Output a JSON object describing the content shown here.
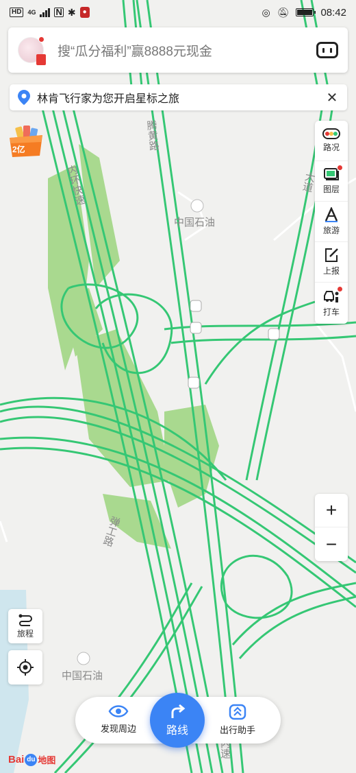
{
  "status_bar": {
    "left_badges": [
      "HD",
      "4G"
    ],
    "time": "08:42"
  },
  "search": {
    "placeholder": "搜“瓜分福利”赢8888元现金"
  },
  "notice": {
    "text": "林肯飞行家为您开启星标之旅"
  },
  "promo": {
    "badge": "2亿"
  },
  "toolbar": {
    "items": [
      {
        "label": "路况",
        "icon": "traffic-light-icon"
      },
      {
        "label": "图层",
        "icon": "layers-icon"
      },
      {
        "label": "旅游",
        "icon": "travel-icon"
      },
      {
        "label": "上报",
        "icon": "report-icon"
      },
      {
        "label": "打车",
        "icon": "taxi-icon"
      }
    ]
  },
  "zoom": {
    "in": "+",
    "out": "−"
  },
  "left_buttons": {
    "itinerary": "旅程"
  },
  "bottom": {
    "discover": "发现周边",
    "route": "路线",
    "assistant": "出行助手"
  },
  "map_labels": {
    "road_tenghuang": "腾黄路",
    "road_inner_ring": "内环快速",
    "road_gong": "弹工路",
    "road_right_top": "大道",
    "road_bottom": "内速",
    "poi_petrochina_1": "中国石油",
    "poi_petrochina_2": "中国石油"
  },
  "logo": {
    "part1": "Bai",
    "part2": "du",
    "part3": "地图"
  },
  "colors": {
    "road_green": "#35c774",
    "park_green": "#a9d98f",
    "accent_blue": "#3b84f5",
    "badge_red": "#e53935"
  }
}
